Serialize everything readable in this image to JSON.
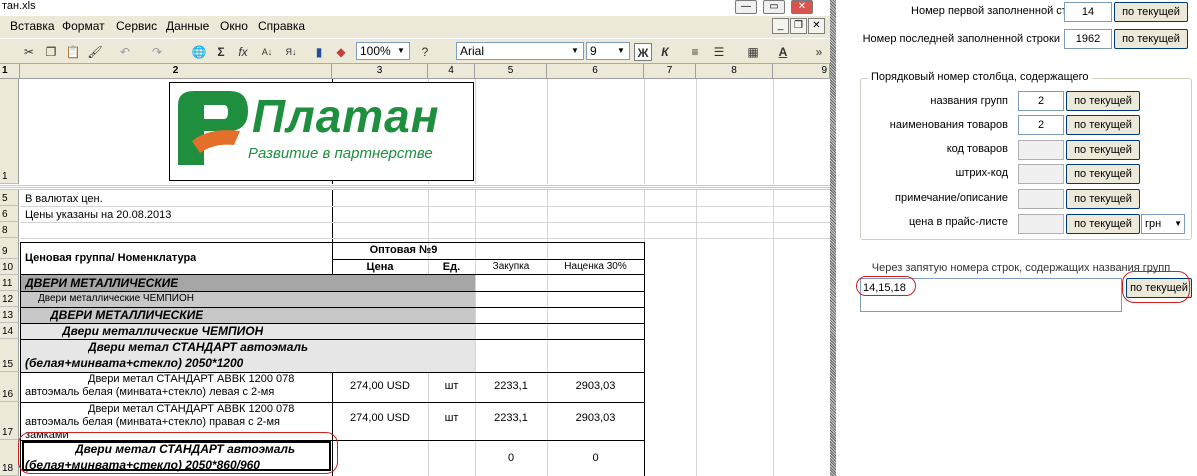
{
  "window": {
    "title": "тан.xls",
    "min_label": "—",
    "max_label": "▭",
    "close_label": "✕"
  },
  "menu": [
    "Вставка",
    "Формат",
    "Сервис",
    "Данные",
    "Окно",
    "Справка"
  ],
  "toolbar": {
    "zoom": "100%",
    "font_name": "Arial",
    "font_size": "9",
    "bold_label": "Ж",
    "italic_label": "К"
  },
  "columns": [
    "1",
    "2",
    "3",
    "4",
    "5",
    "6",
    "7",
    "8",
    "9"
  ],
  "rows": [
    "1",
    "5",
    "6",
    "8",
    "9",
    "10",
    "11",
    "12",
    "13",
    "14",
    "15",
    "16",
    "17",
    "18"
  ],
  "logo": {
    "brand": "Платан",
    "slogan": "Развитие в партнерстве"
  },
  "sheet": {
    "r5": "В валютах цен.",
    "r6": "Цены указаны на 20.08.2013",
    "r9_group": "Ценовая группа/ Номенклатура",
    "r9_opt": "Оптовая №9",
    "r10_price": "Цена",
    "r10_unit": "Ед.",
    "r10_buy": "Закупка",
    "r10_markup": "Наценка 30%",
    "r11": "ДВЕРИ МЕТАЛЛИЧЕСКИЕ",
    "r12": "Двери металлические ЧЕМПИОН",
    "r13": "ДВЕРИ МЕТАЛЛИЧЕСКИЕ",
    "r14": "Двери металлические ЧЕМПИОН",
    "r15_a": "Двери метал СТАНДАРТ автоэмаль",
    "r15_b": "(белая+минвата+стекло) 2050*1200",
    "r16_a": "Двери метал СТАНДАРТ АВВК 1200 078",
    "r16_b": "автоэмаль белая (минвата+стекло) левая с 2-мя",
    "r16_price": "274,00 USD",
    "r16_unit": "шт",
    "r16_buy": "2233,1",
    "r16_markup": "2903,03",
    "r17_a": "Двери метал СТАНДАРТ АВВК 1200 078",
    "r17_b": "автоэмаль белая (минвата+стекло) правая с 2-мя",
    "r17_c": "замками",
    "r17_price": "274,00 USD",
    "r17_unit": "шт",
    "r17_buy": "2233,1",
    "r17_markup": "2903,03",
    "r18_a": "Двери метал СТАНДАРТ автоэмаль",
    "r18_b": "(белая+минвата+стекло) 2050*860/960",
    "r18_buy": "0",
    "r18_markup": "0"
  },
  "panel": {
    "first_row_label": "Номер первой заполненной строки",
    "first_row_value": "14",
    "last_row_label": "Номер последней заполненной строки",
    "last_row_value": "1962",
    "current_btn": "по текущей",
    "group_title": "Порядковый номер столбца, содержащего",
    "fields": [
      {
        "label": "названия групп",
        "value": "2"
      },
      {
        "label": "наименования товаров",
        "value": "2"
      },
      {
        "label": "код товаров",
        "value": ""
      },
      {
        "label": "штрих-код",
        "value": ""
      },
      {
        "label": "примечание/описание",
        "value": ""
      },
      {
        "label": "цена в прайс-листе",
        "value": ""
      }
    ],
    "currency": "грн",
    "group_rows_label": "Через запятую номера строк, содержащих названия групп",
    "group_rows_value": "14,15,18"
  }
}
